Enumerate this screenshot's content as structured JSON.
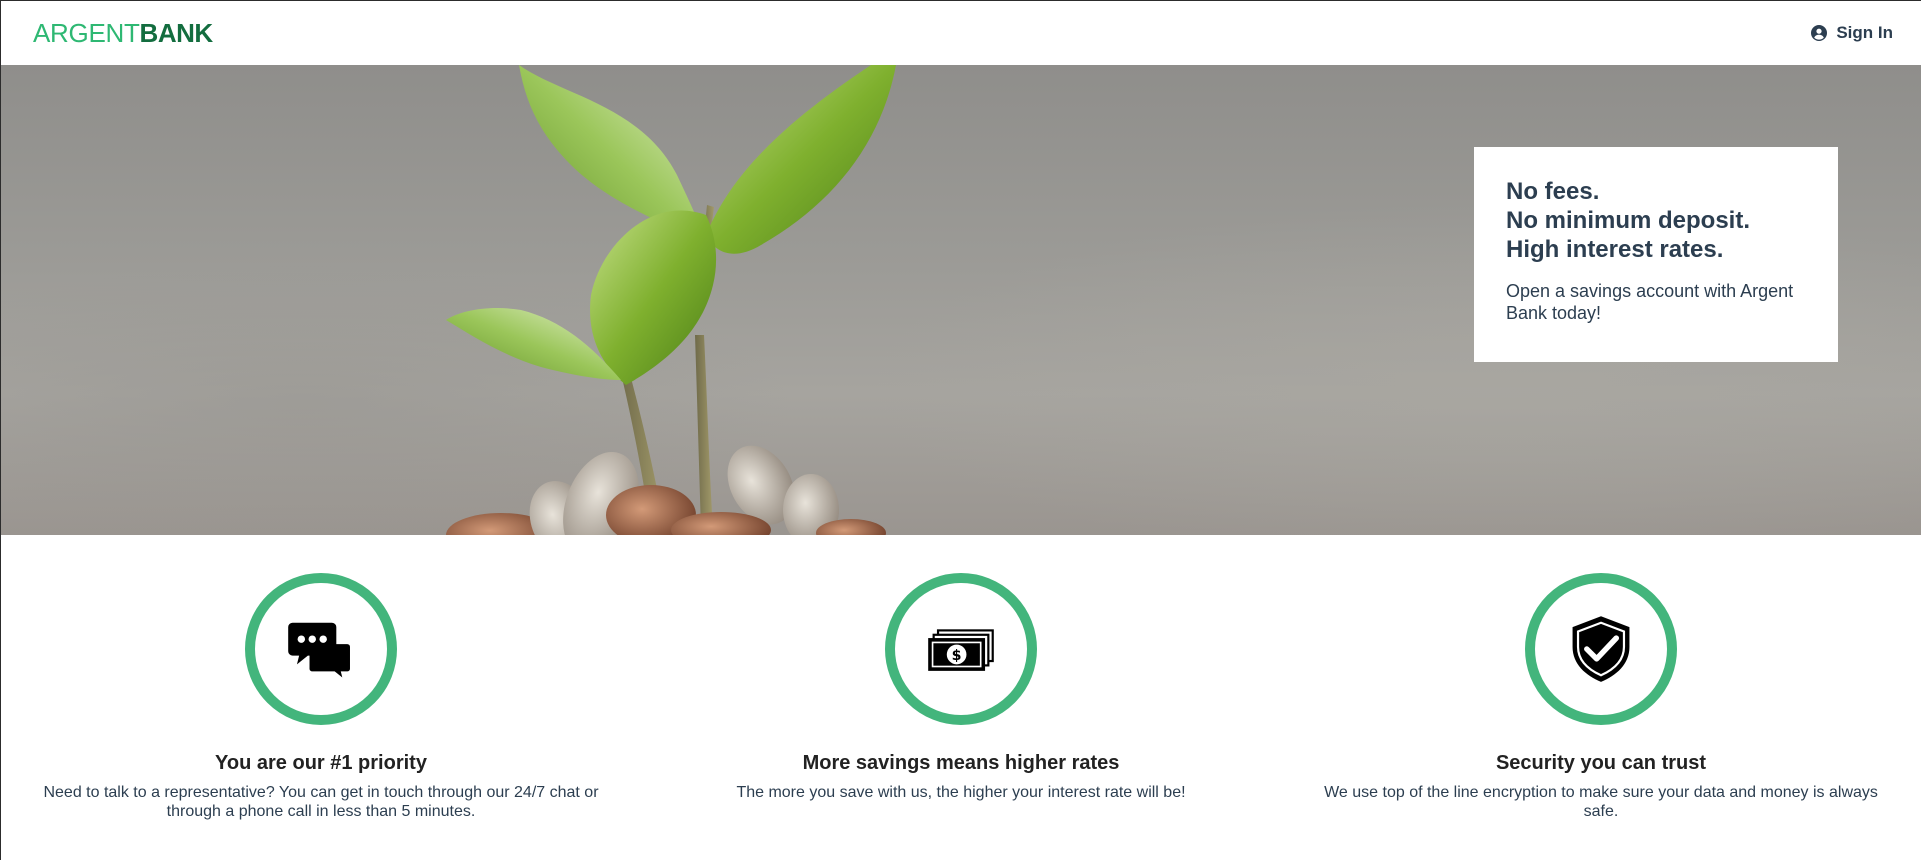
{
  "nav": {
    "logo_part1": "ARGENT",
    "logo_part2": "BANK",
    "signin_label": "Sign In",
    "signin_icon": "user-circle-icon"
  },
  "hero": {
    "subtitles": [
      "No fees.",
      "No minimum deposit.",
      "High interest rates."
    ],
    "text": "Open a savings account with Argent Bank today!"
  },
  "features": [
    {
      "icon": "chat-icon",
      "title": "You are our #1 priority",
      "text": "Need to talk to a representative? You can get in touch through our 24/7 chat or through a phone call in less than 5 minutes."
    },
    {
      "icon": "money-icon",
      "title": "More savings means higher rates",
      "text": "The more you save with us, the higher your interest rate will be!"
    },
    {
      "icon": "security-icon",
      "title": "Security you can trust",
      "text": "We use top of the line encryption to make sure your data and money is always safe."
    }
  ],
  "colors": {
    "brand_green": "#2eb873",
    "brand_dark_green": "#136d3f",
    "ring_green": "#43b57c",
    "text": "#2c3e50"
  }
}
